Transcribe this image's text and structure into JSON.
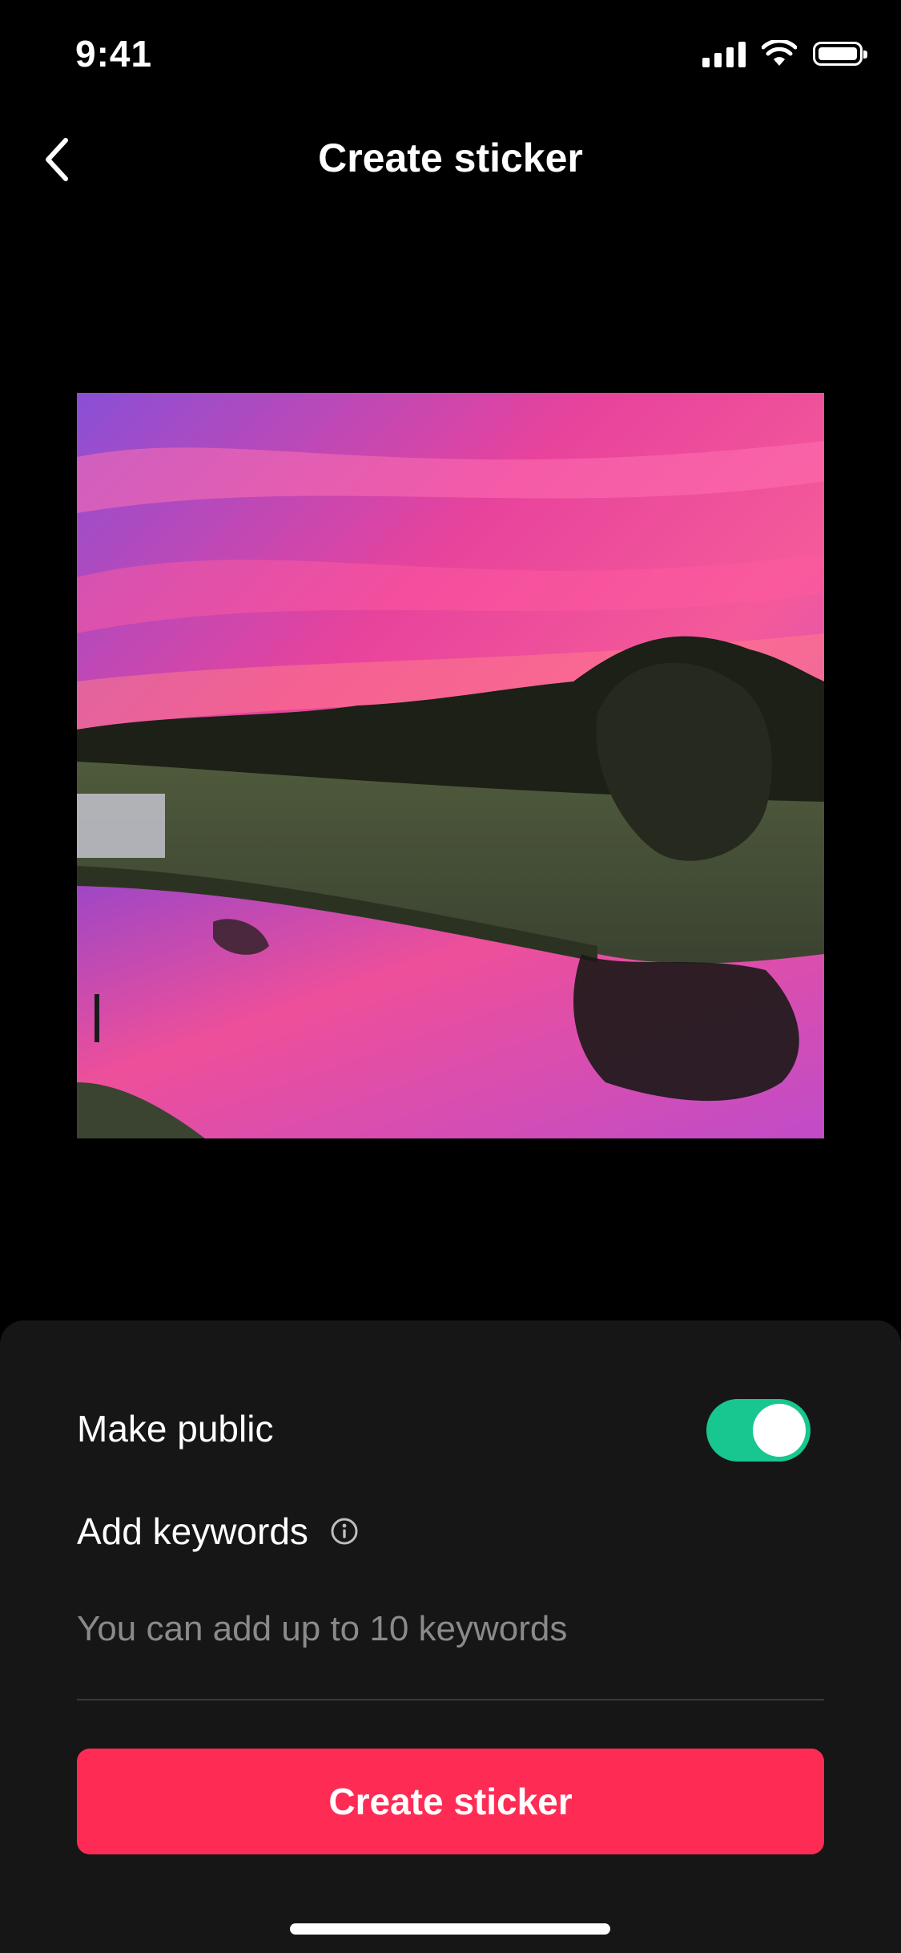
{
  "status_bar": {
    "time": "9:41",
    "icons": [
      "cellular-signal-icon",
      "wifi-icon",
      "battery-icon"
    ]
  },
  "header": {
    "title": "Create sticker",
    "back_icon": "chevron-left-icon"
  },
  "preview": {
    "description": "sunset landscape photo"
  },
  "settings": {
    "make_public_label": "Make public",
    "make_public_on": true,
    "add_keywords_label": "Add keywords",
    "info_icon": "info-icon",
    "keywords_placeholder": "You can add up to 10 keywords",
    "keywords_value": ""
  },
  "actions": {
    "create_label": "Create sticker"
  },
  "colors": {
    "background": "#000000",
    "sheet": "#161616",
    "toggle_on": "#18c68f",
    "primary_button": "#fe2c55",
    "placeholder": "#8a8a8a"
  }
}
